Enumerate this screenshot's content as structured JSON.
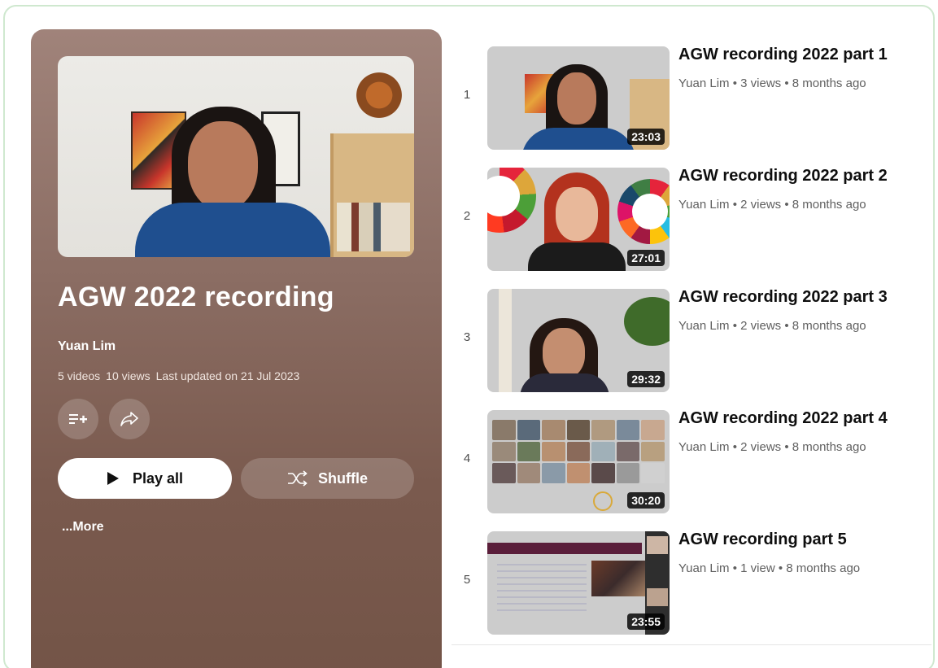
{
  "playlist": {
    "title": "AGW 2022 recording",
    "owner": "Yuan Lim",
    "video_count": "5 videos",
    "view_count": "10 views",
    "last_updated": "Last updated on 21 Jul 2023",
    "play_all_label": "Play all",
    "shuffle_label": "Shuffle",
    "more_label": "...More",
    "icons": {
      "add": "add-to-queue-icon",
      "share": "share-icon",
      "play": "play-icon",
      "shuffle": "shuffle-icon"
    }
  },
  "videos": [
    {
      "index": "1",
      "title": "AGW recording 2022 part 1",
      "meta": "Yuan Lim • 3 views • 8 months ago",
      "duration": "23:03"
    },
    {
      "index": "2",
      "title": "AGW recording 2022 part 2",
      "meta": "Yuan Lim • 2 views • 8 months ago",
      "duration": "27:01"
    },
    {
      "index": "3",
      "title": "AGW recording 2022 part 3",
      "meta": "Yuan Lim • 2 views • 8 months ago",
      "duration": "29:32"
    },
    {
      "index": "4",
      "title": "AGW recording 2022 part 4",
      "meta": "Yuan Lim • 2 views • 8 months ago",
      "duration": "30:20"
    },
    {
      "index": "5",
      "title": "AGW recording part 5",
      "meta": "Yuan Lim • 1 view • 8 months ago",
      "duration": "23:55"
    }
  ],
  "colors": {
    "panel": "#8a6c62",
    "frame_border": "#cfe8cf",
    "title_text": "#0f0f0f",
    "meta_text": "#606060"
  }
}
